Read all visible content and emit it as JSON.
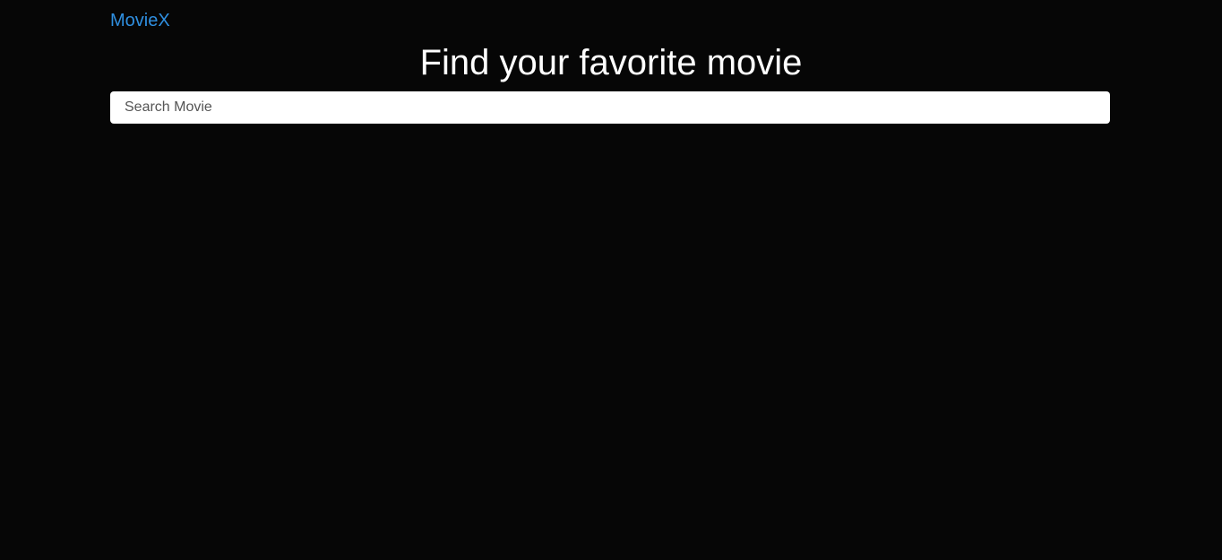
{
  "header": {
    "brand": "MovieX"
  },
  "hero": {
    "title": "Find your favorite movie"
  },
  "search": {
    "placeholder": "Search Movie",
    "value": ""
  },
  "colors": {
    "background": "#060606",
    "brand": "#2f8fe0",
    "title": "#ffffff",
    "input_background": "#ffffff"
  }
}
